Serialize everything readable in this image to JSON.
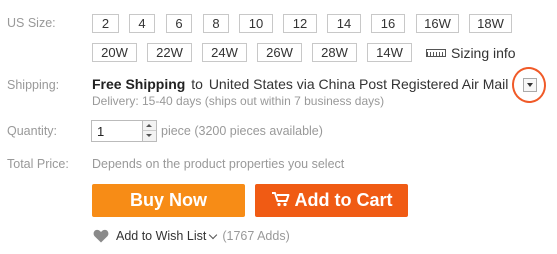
{
  "labels": {
    "size": "US Size:",
    "shipping": "Shipping:",
    "quantity": "Quantity:",
    "total_price": "Total Price:"
  },
  "sizes": [
    "2",
    "4",
    "6",
    "8",
    "10",
    "12",
    "14",
    "16",
    "16W",
    "18W",
    "20W",
    "22W",
    "24W",
    "26W",
    "28W",
    "14W"
  ],
  "sizing_info": "Sizing info",
  "shipping": {
    "method": "Free Shipping",
    "to": "to",
    "destination": "United States via China Post Registered Air Mail",
    "delivery": "Delivery: 15-40 days (ships out within 7 business days)"
  },
  "quantity": {
    "value": "1",
    "unit_note": "piece (3200 pieces available)"
  },
  "total_price": {
    "note": "Depends on the product properties you select"
  },
  "buttons": {
    "buy_now": "Buy Now",
    "add_to_cart": "Add to Cart"
  },
  "wishlist": {
    "label": "Add to Wish List",
    "count": "(1767 Adds)"
  },
  "colors": {
    "buy_now": "#f78c16",
    "add_to_cart": "#f05b14",
    "annotation_circle": "#f05a28"
  }
}
